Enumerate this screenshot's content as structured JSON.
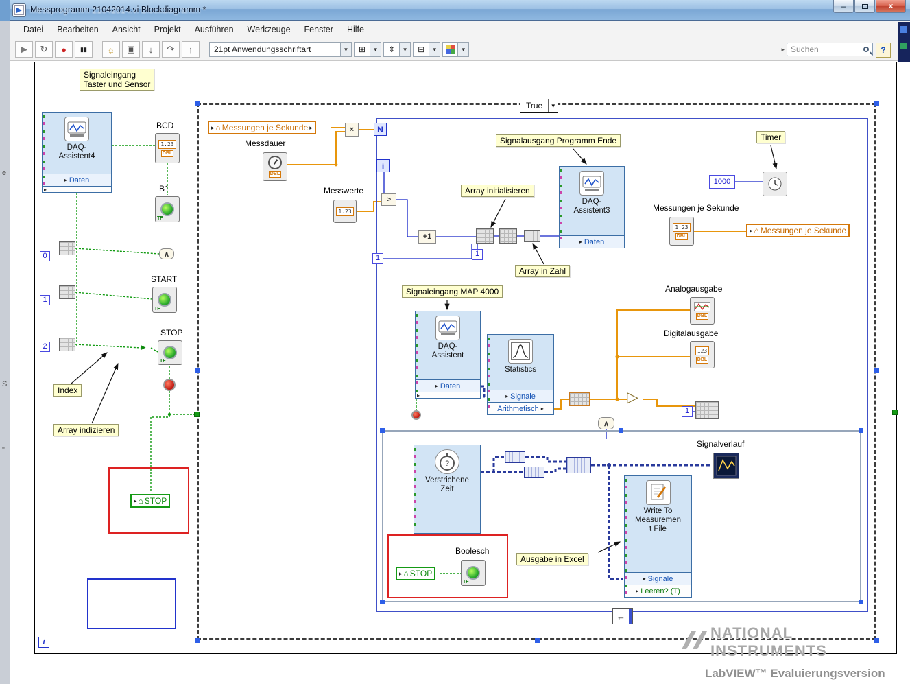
{
  "window": {
    "title": "Messprogramm 21042014.vi Blockdiagramm *"
  },
  "menu": {
    "items": [
      "Datei",
      "Bearbeiten",
      "Ansicht",
      "Projekt",
      "Ausführen",
      "Werkzeuge",
      "Fenster",
      "Hilfe"
    ]
  },
  "toolbar": {
    "font_selector": "21pt Anwendungsschriftart",
    "search_text": "Suchen"
  },
  "glyphs": {
    "run": "▶",
    "run_continuous": "↻",
    "abort": "●",
    "pause": "▮▮",
    "highlight": "☼",
    "retain": "▣",
    "step_into": "↓",
    "step_over": "↷",
    "step_out": "↑",
    "dropdown": "▼",
    "minimize": "–",
    "close": "×",
    "local_var": "⌂",
    "arrow_right": "▸",
    "arrow_left": "◂",
    "multiply": "×",
    "greater": ">",
    "increment": "+1",
    "and": "∧",
    "feedback": "←",
    "info": "i",
    "help": "?",
    "question": "?",
    "triangle": "▷",
    "align": "⊞",
    "distribute": "⇕",
    "resize": "⊟"
  },
  "faces": {
    "num": "1.23",
    "digits": "123",
    "dbl": "DBL",
    "tf": "TF"
  },
  "left_pane": {
    "comment": "Signaleingang\nTaster und Sensor",
    "daq4_name": "DAQ-\nAssistent4",
    "daq4_daten": "Daten",
    "bcd": "BCD",
    "b1": "B1",
    "start": "START",
    "stop": "STOP",
    "c0": "0",
    "c1": "1",
    "c2": "2",
    "index_label": "Index",
    "array_indizieren": "Array indizieren",
    "stop_local": "STOP"
  },
  "case": {
    "selector": "True",
    "mjs_local_left": "Messungen je Sekunde",
    "messdauer": "Messdauer",
    "messwerte": "Messwerte",
    "n": "N",
    "i": "i",
    "one_a": "1",
    "one_b": "1",
    "one_c": "1",
    "c1000": "1000",
    "array_init": "Array initialisieren",
    "array_in_zahl": "Array in Zahl",
    "signalausgang": "Signalausgang Programm Ende",
    "daq3_name": "DAQ-\nAssistent3",
    "daq3_daten": "Daten",
    "timer": "Timer",
    "mjs_ind_label": "Messungen je Sekunde",
    "mjs_local_right": "Messungen je Sekunde",
    "map4000": "Signaleingang MAP 4000",
    "daq1_name": "DAQ-\nAssistent",
    "daq1_daten": "Daten",
    "stats_name": "Statistics",
    "stats_signale": "Signale",
    "stats_arith": "Arithmetisch",
    "analogausgabe": "Analogausgabe",
    "digitalausgabe": "Digitalausgabe"
  },
  "inner": {
    "verstrichene": "Verstrichene\nZeit",
    "stop_local": "STOP",
    "boolesch": "Boolesch",
    "ausgabe_excel": "Ausgabe in Excel",
    "write_name": "Write To\nMeasuremen\nt File",
    "write_signale": "Signale",
    "write_leeren": "Leeren? (T)",
    "signalverlauf": "Signalverlauf"
  },
  "watermark": {
    "l1": "NATIONAL",
    "l2": "INSTRUMENTS",
    "l3": "LabVIEW™ Evaluierungsversion"
  },
  "edge": {
    "f0": "e",
    "f1": "S",
    "f2": "\""
  }
}
